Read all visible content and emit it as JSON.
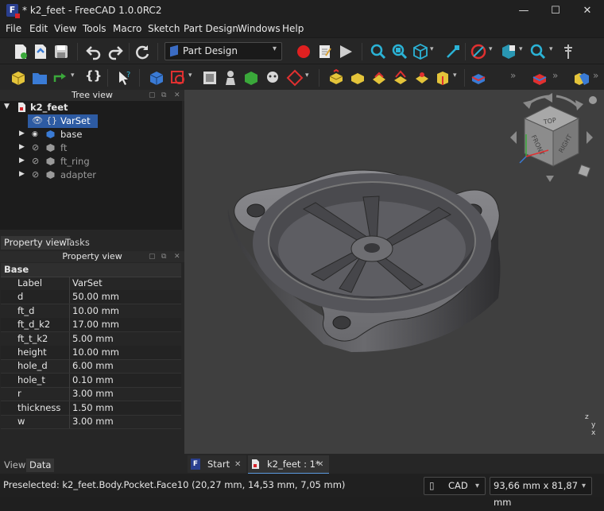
{
  "window": {
    "title": "* k2_feet - FreeCAD 1.0.0RC2",
    "logo_letter": "F",
    "minimize": "—",
    "maximize": "☐",
    "close": "✕"
  },
  "menu": {
    "file": "File",
    "edit": "Edit",
    "view": "View",
    "tools": "Tools",
    "macro": "Macro",
    "sketch": "Sketch",
    "part_design": "Part Design",
    "windows": "Windows",
    "help": "Help"
  },
  "toolbar": {
    "workbench": "Part Design",
    "overflow": "»",
    "macro_glyph": "{}"
  },
  "tree_view": {
    "title": "Tree view",
    "root": "k2_feet",
    "items": [
      {
        "label": "VarSet",
        "selected": true
      },
      {
        "label": "base"
      },
      {
        "label": "ft"
      },
      {
        "label": "ft_ring"
      },
      {
        "label": "adapter"
      }
    ]
  },
  "panel_tabs": {
    "property_view": "Property view",
    "tasks": "Tasks"
  },
  "property_view": {
    "title": "Property view",
    "group": "Base",
    "rows": [
      {
        "key": "Label",
        "value": "VarSet"
      },
      {
        "key": "d",
        "value": "50.00 mm"
      },
      {
        "key": "ft_d",
        "value": "10.00 mm"
      },
      {
        "key": "ft_d_k2",
        "value": "17.00 mm"
      },
      {
        "key": "ft_t_k2",
        "value": "5.00 mm"
      },
      {
        "key": "height",
        "value": "10.00 mm"
      },
      {
        "key": "hole_d",
        "value": "6.00 mm"
      },
      {
        "key": "hole_t",
        "value": "0.10 mm"
      },
      {
        "key": "r",
        "value": "3.00 mm"
      },
      {
        "key": "thickness",
        "value": "1.50 mm"
      },
      {
        "key": "w",
        "value": "3.00 mm"
      }
    ]
  },
  "bottom_tabs": {
    "view": "View",
    "data": "Data"
  },
  "nav_cube": {
    "top": "TOP",
    "front": "FRONT",
    "right": "RIGHT"
  },
  "axis": {
    "x": "x",
    "y": "y",
    "z": "z"
  },
  "doc_tabs": [
    {
      "label": "Start",
      "close": "✕"
    },
    {
      "label": "k2_feet : 1*",
      "close": "✕"
    }
  ],
  "status": {
    "text": "Preselected: k2_feet.Body.Pocket.Face10 (20,27 mm, 14,53 mm, 7,05 mm)",
    "nav_style": "CAD",
    "dimensions": "93,66 mm x 81,87 mm"
  }
}
